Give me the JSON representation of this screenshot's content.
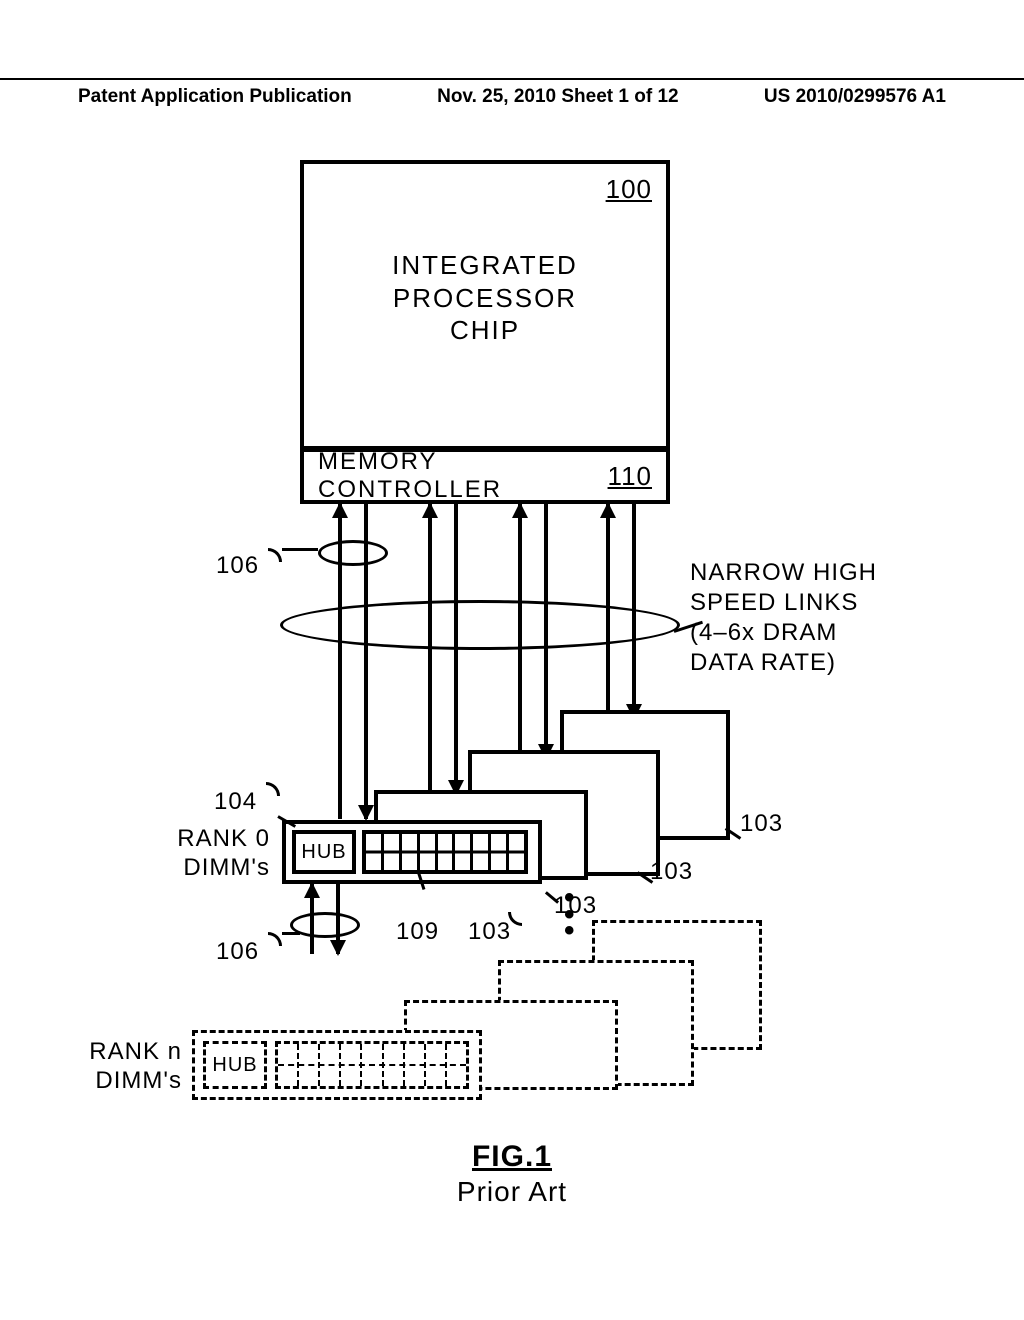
{
  "header": {
    "left": "Patent Application Publication",
    "center": "Nov. 25, 2010  Sheet 1 of 12",
    "right": "US 2010/0299576 A1"
  },
  "chip": {
    "ref": "100",
    "label_line1": "INTEGRATED",
    "label_line2": "PROCESSOR",
    "label_line3": "CHIP"
  },
  "memory_controller": {
    "label": "MEMORY CONTROLLER",
    "ref": "110"
  },
  "refs": {
    "links_top": "106",
    "links_bottom": "106",
    "dimm_front": "104",
    "dimm_stack": [
      "103",
      "103",
      "103",
      "103"
    ],
    "chips_on_dimm": "109"
  },
  "annotations": {
    "links_side_l1": "NARROW HIGH",
    "links_side_l2": "SPEED LINKS",
    "links_side_l3": "(4–6x DRAM",
    "links_side_l4": "DATA RATE)",
    "rank0_l1": "RANK 0",
    "rank0_l2": "DIMM's",
    "rankn_l1": "RANK n",
    "rankn_l2": "DIMM's",
    "hub": "HUB"
  },
  "figure": {
    "num": "FIG.1",
    "prior": "Prior Art"
  }
}
